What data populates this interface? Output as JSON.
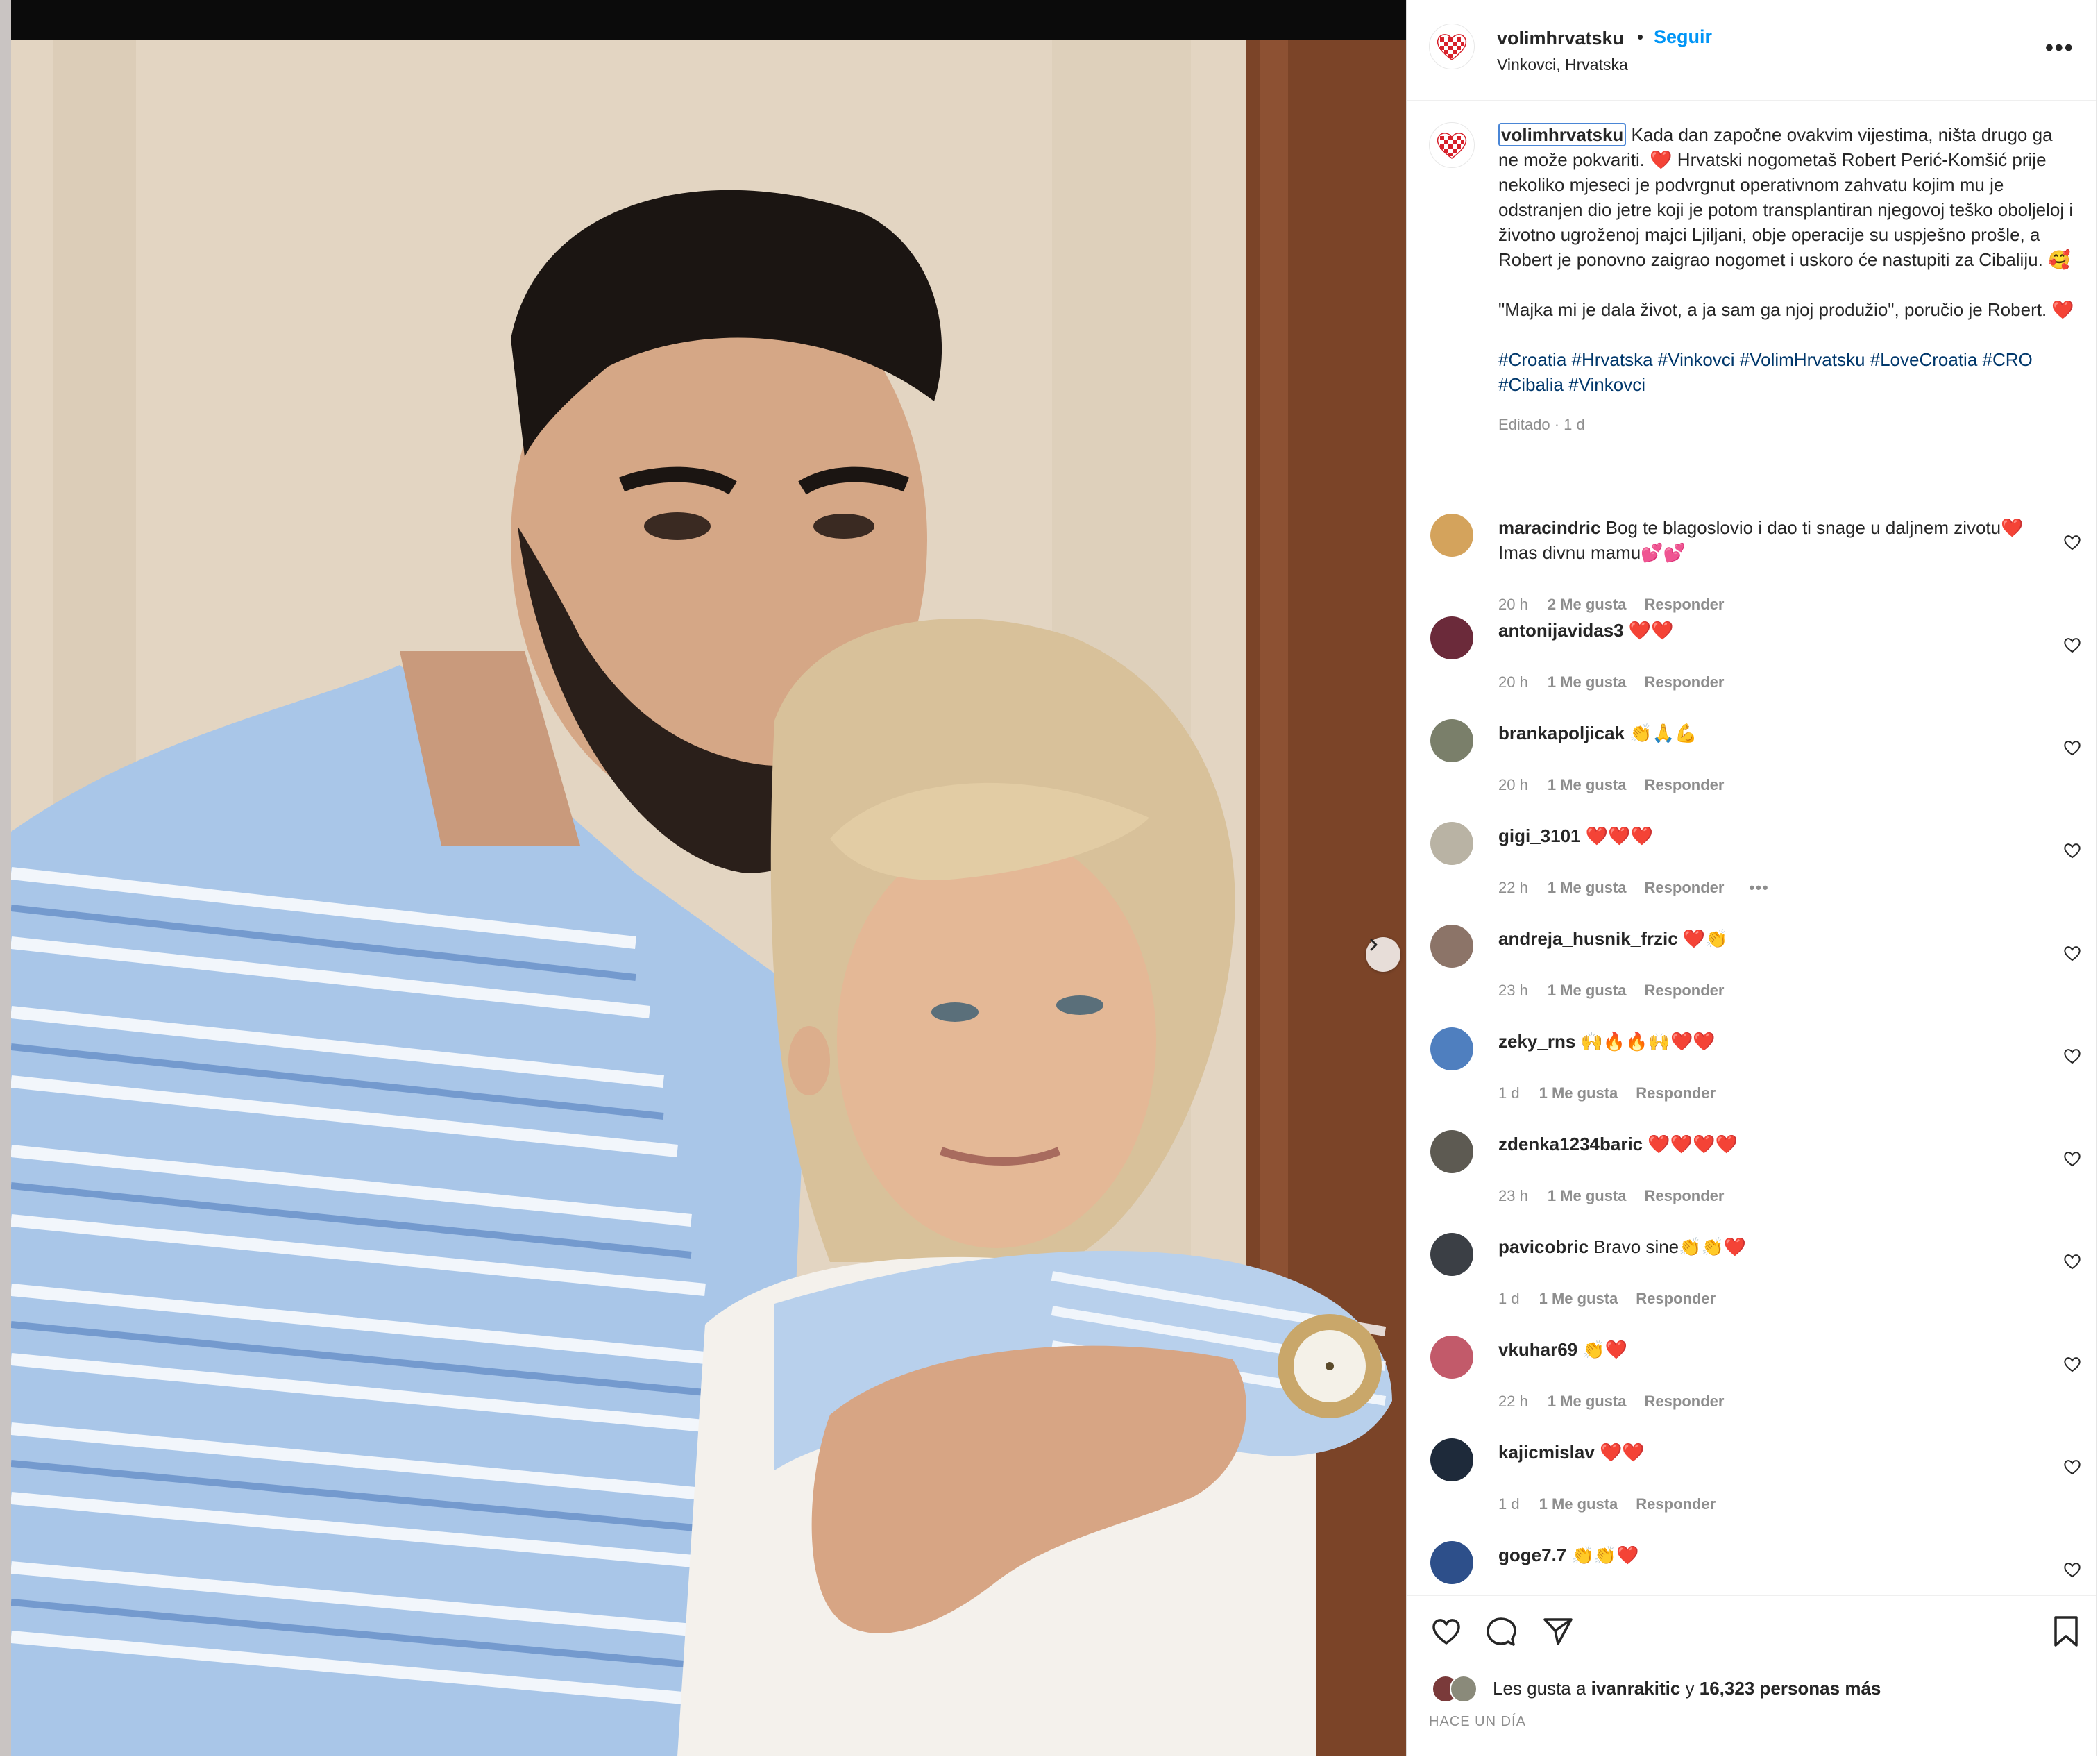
{
  "post": {
    "username": "volimhrvatsku",
    "dot": "•",
    "follow_label": "Seguir",
    "location": "Vinkovci, Hrvatska",
    "more_label": "•••"
  },
  "caption": {
    "username": "volimhrvatsku",
    "text": " Kada dan započne ovakvim vijestima, ništa drugo ga ne može pokvariti. ❤️ Hrvatski nogometaš Robert Perić-Komšić prije nekoliko mjeseci je podvrgnut operativnom zahvatu kojim mu je odstranjen dio jetre koji je potom transplantiran njegovoj teško oboljeloj i životno ugroženoj majci Ljiljani, obje operacije su uspješno prošle, a Robert je ponovno zaigrao nogomet i uskoro će nastupiti za Cibaliju. 🥰",
    "quote": "\"Majka mi je dala život, a ja sam ga njoj produžio\", poručio je Robert. ❤️",
    "hashtags": "#Croatia #Hrvatska #Vinkovci #VolimHrvatsku #LoveCroatia #CRO #Cibalia #Vinkovci",
    "meta": "Editado · 1 d"
  },
  "comments": [
    {
      "user": "maracindric",
      "text": "Bog te blagoslovio i dao ti snage u daljnem zivotu❤️ Imas divnu mamu💕💕",
      "time": "20 h",
      "likes": "2 Me gusta",
      "reply": "Responder",
      "avatar_color": "#d4a35c"
    },
    {
      "user": "antonijavidas3",
      "text": "❤️❤️",
      "time": "20 h",
      "likes": "1 Me gusta",
      "reply": "Responder",
      "avatar_color": "#6b2a3a"
    },
    {
      "user": "brankapoljicak",
      "text": "👏🙏💪",
      "time": "20 h",
      "likes": "1 Me gusta",
      "reply": "Responder",
      "avatar_color": "#7a7f6a"
    },
    {
      "user": "gigi_3101",
      "text": "❤️❤️❤️",
      "time": "22 h",
      "likes": "1 Me gusta",
      "reply": "Responder",
      "avatar_color": "#b9b3a4"
    },
    {
      "user": "andreja_husnik_frzic",
      "text": "❤️👏",
      "time": "23 h",
      "likes": "1 Me gusta",
      "reply": "Responder",
      "avatar_color": "#8c7468"
    },
    {
      "user": "zeky_rns",
      "text": "🙌🔥🔥🙌❤️❤️",
      "time": "1 d",
      "likes": "1 Me gusta",
      "reply": "Responder",
      "avatar_color": "#4f7fbf"
    },
    {
      "user": "zdenka1234baric",
      "text": "❤️❤️❤️❤️",
      "time": "23 h",
      "likes": "1 Me gusta",
      "reply": "Responder",
      "avatar_color": "#5d5a52"
    },
    {
      "user": "pavicobric",
      "text": "Bravo sine👏👏❤️",
      "time": "1 d",
      "likes": "1 Me gusta",
      "reply": "Responder",
      "avatar_color": "#3b3f45"
    },
    {
      "user": "vkuhar69",
      "text": "👏❤️",
      "time": "22 h",
      "likes": "1 Me gusta",
      "reply": "Responder",
      "avatar_color": "#c25a6a"
    },
    {
      "user": "kajicmislav",
      "text": "❤️❤️",
      "time": "1 d",
      "likes": "1 Me gusta",
      "reply": "Responder",
      "avatar_color": "#1e2a3a"
    },
    {
      "user": "goge7.7",
      "text": "👏👏❤️",
      "time": "",
      "likes": "",
      "reply": "",
      "avatar_color": "#2d4f8a"
    }
  ],
  "more_options": "•••",
  "actions": {
    "likes_prefix": "Les gusta a ",
    "liker": "ivanrakitic",
    "likes_mid": " y ",
    "likes_count": "16,323 personas más",
    "time_ago": "HACE UN DÍA"
  }
}
